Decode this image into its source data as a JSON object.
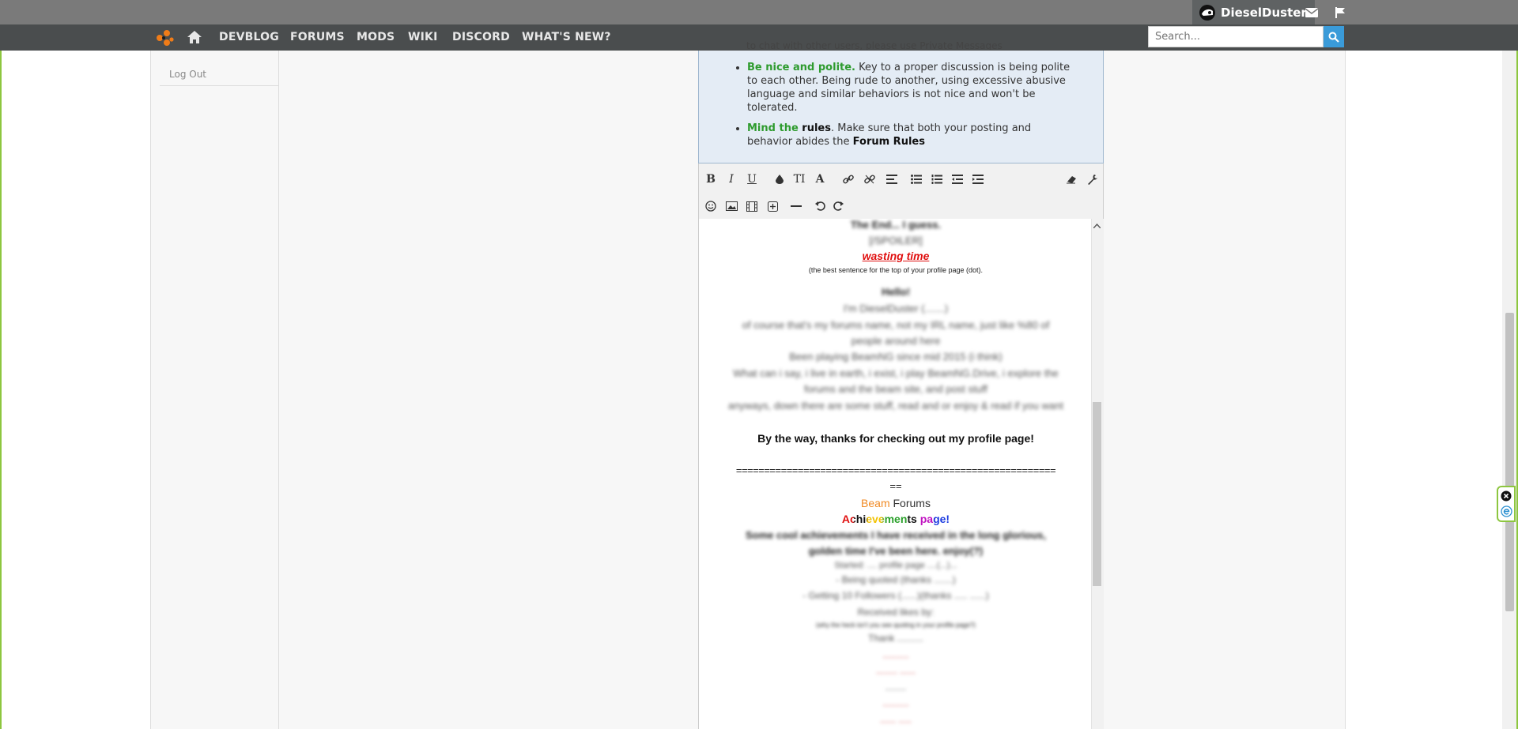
{
  "header": {
    "username": "DieselDuster",
    "nav": [
      "DEVBLOG",
      "FORUMS",
      "MODS",
      "WIKI",
      "DISCORD",
      "WHAT'S NEW?"
    ],
    "search_placeholder": "Search..."
  },
  "sidebar": {
    "logout": "Log Out",
    "cut_text": "..."
  },
  "rules": {
    "cut_line": "to chat with other users, please use Private Messages",
    "items": [
      {
        "lead": "Be nice and polite.",
        "text": " Key to a proper discussion is being polite to each other. Being rude to another, using excessive abusive language and similar behaviors is not nice and won't be tolerated."
      },
      {
        "lead": "Mind the",
        "lead2": " rules",
        "text": ". Make sure that both your posting and behavior abides the ",
        "link": "Forum Rules"
      }
    ]
  },
  "editor": {
    "lines": [
      "The End... I guess.",
      "[/SPOILER]",
      "wasting time",
      "(the best sentence for the top of your profile page (dot).",
      "Hello!",
      "I'm DieselDuster (.......)",
      "of course that's my forums name, not my IRL name, just like %80 of",
      "people around here",
      "Been playing BeamNG since mid 2015 (i think)",
      "What can i say, i live in earth, i exist, i play BeamNG.Drive, i explore the",
      "forums and the beam site, and post stuff",
      "anyways, down there are some stuff, read and or enjoy & read if you want",
      "By the way, thanks for checking out my profile page!",
      "=========================================================",
      "==",
      "Beam",
      " Forums",
      "Achievements page!",
      "Some cool achievements I have received in the long glorious,",
      "golden time I've been here. enjoy(?)",
      "Started: .... profile page ....(...)...",
      "- Being quoted (thanks .......)",
      "- Getting 10 Followers (......)(thanks ..... ......)",
      "Received likes by:",
      "(why the heck isn't you see quoting in your profile page?)",
      "Thank ..........",
      "..........",
      "........ ......",
      "........",
      "..........",
      "...... ....."
    ]
  },
  "colors": {
    "accent_green": "#8dc63f",
    "nav_bg": "#4a4d4e",
    "top_bg": "#7a7a7a",
    "search_btn": "#3a9bd9",
    "rules_green": "#2e9b2e",
    "wasting_red": "#e01010",
    "beam_orange": "#f08a24"
  }
}
